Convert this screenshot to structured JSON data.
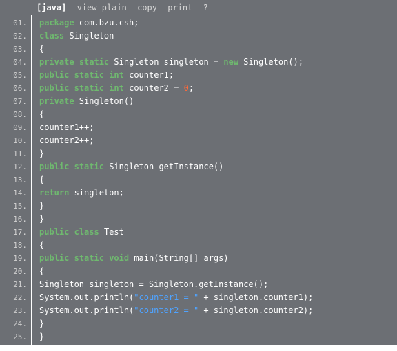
{
  "toolbar": {
    "lang": "[java]",
    "view_plain": "view plain",
    "copy": "copy",
    "print": "print",
    "help": "?"
  },
  "gutter": [
    "01.",
    "02.",
    "03.",
    "04.",
    "05.",
    "06.",
    "07.",
    "08.",
    "09.",
    "10.",
    "11.",
    "12.",
    "13.",
    "14.",
    "15.",
    "16.",
    "17.",
    "18.",
    "19.",
    "20.",
    "21.",
    "22.",
    "23.",
    "24.",
    "25."
  ],
  "code": {
    "l1": {
      "kw": "package",
      "rest": " com.bzu.csh;"
    },
    "l2": {
      "kw": "class",
      "name": " Singleton"
    },
    "l3": "{",
    "l4": {
      "kw1": "private",
      "kw2": "static",
      "type": "Singleton",
      "name": "singleton",
      "eq": " = ",
      "newk": "new",
      "ctor": " Singleton();"
    },
    "l5": {
      "kw1": "public",
      "kw2": "static",
      "kw3": "int",
      "name": " counter1;"
    },
    "l6": {
      "kw1": "public",
      "kw2": "static",
      "kw3": "int",
      "name": " counter2 = ",
      "num": "0",
      "tail": ";"
    },
    "l7": {
      "kw": "private",
      "name": " Singleton()"
    },
    "l8": "{",
    "l9": "counter1++;",
    "l10": "counter2++;",
    "l11": "}",
    "l12": {
      "kw1": "public",
      "kw2": "static",
      "type": "Singleton",
      "name": "getInstance()"
    },
    "l13": "{",
    "l14": {
      "kw": "return",
      "name": " singleton;"
    },
    "l15": "}",
    "l16": "}",
    "l17": {
      "kw1": "public",
      "kw2": "class",
      "name": " Test"
    },
    "l18": "{",
    "l19": {
      "kw1": "public",
      "kw2": "static",
      "kw3": "void",
      "name": " main(String[] args)"
    },
    "l20": "{",
    "l21": "Singleton singleton = Singleton.getInstance();",
    "l22": {
      "pre": "System.out.println(",
      "str": "\"counter1 = \"",
      "post": " + singleton.counter1);"
    },
    "l23": {
      "pre": "System.out.println(",
      "str": "\"counter2 = \"",
      "post": " + singleton.counter2);"
    },
    "l24": "}",
    "l25": "}"
  }
}
